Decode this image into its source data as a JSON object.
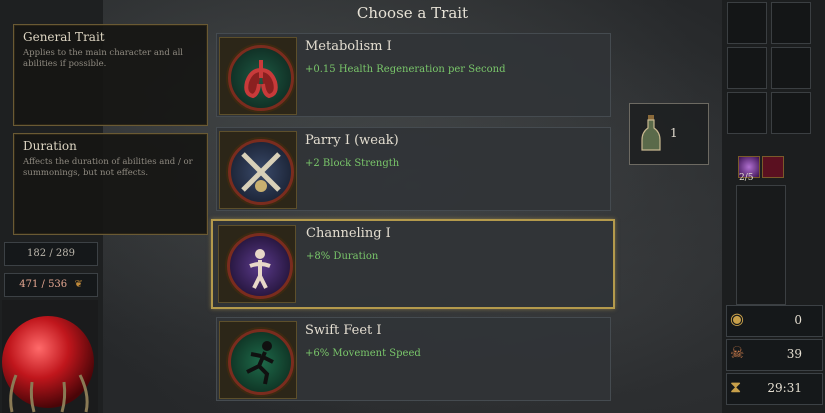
{
  "title": "Choose a Trait",
  "info_boxes": [
    {
      "heading": "General Trait",
      "text": "Applies to the main character and all abilities if possible."
    },
    {
      "heading": "Duration",
      "text": "Affects the duration of abilities and / or summonings, but not effects."
    }
  ],
  "player_stats": {
    "mana": "182 / 289",
    "health": "471 / 536"
  },
  "traits": [
    {
      "name": "Metabolism I",
      "effect": "+0.15 Health Regeneration per Second",
      "icon": "lungs-icon",
      "selected": false
    },
    {
      "name": "Parry I (weak)",
      "effect": "+2 Block Strength",
      "icon": "crossed-swords-icon",
      "selected": false
    },
    {
      "name": "Channeling I",
      "effect": "+8% Duration",
      "icon": "channeling-figure-icon",
      "selected": true
    },
    {
      "name": "Swift Feet I",
      "effect": "+6% Movement Speed",
      "icon": "running-figure-icon",
      "selected": false
    }
  ],
  "potion": {
    "count": "1",
    "icon": "potion-bottle-icon"
  },
  "buffs": {
    "stack": "2/5"
  },
  "resources": {
    "gold": "0",
    "kills": "39",
    "time": "29:31"
  },
  "colors": {
    "accent_gold": "#b49a4c",
    "effect_green": "#79c66a",
    "health_red": "#c0161c"
  }
}
